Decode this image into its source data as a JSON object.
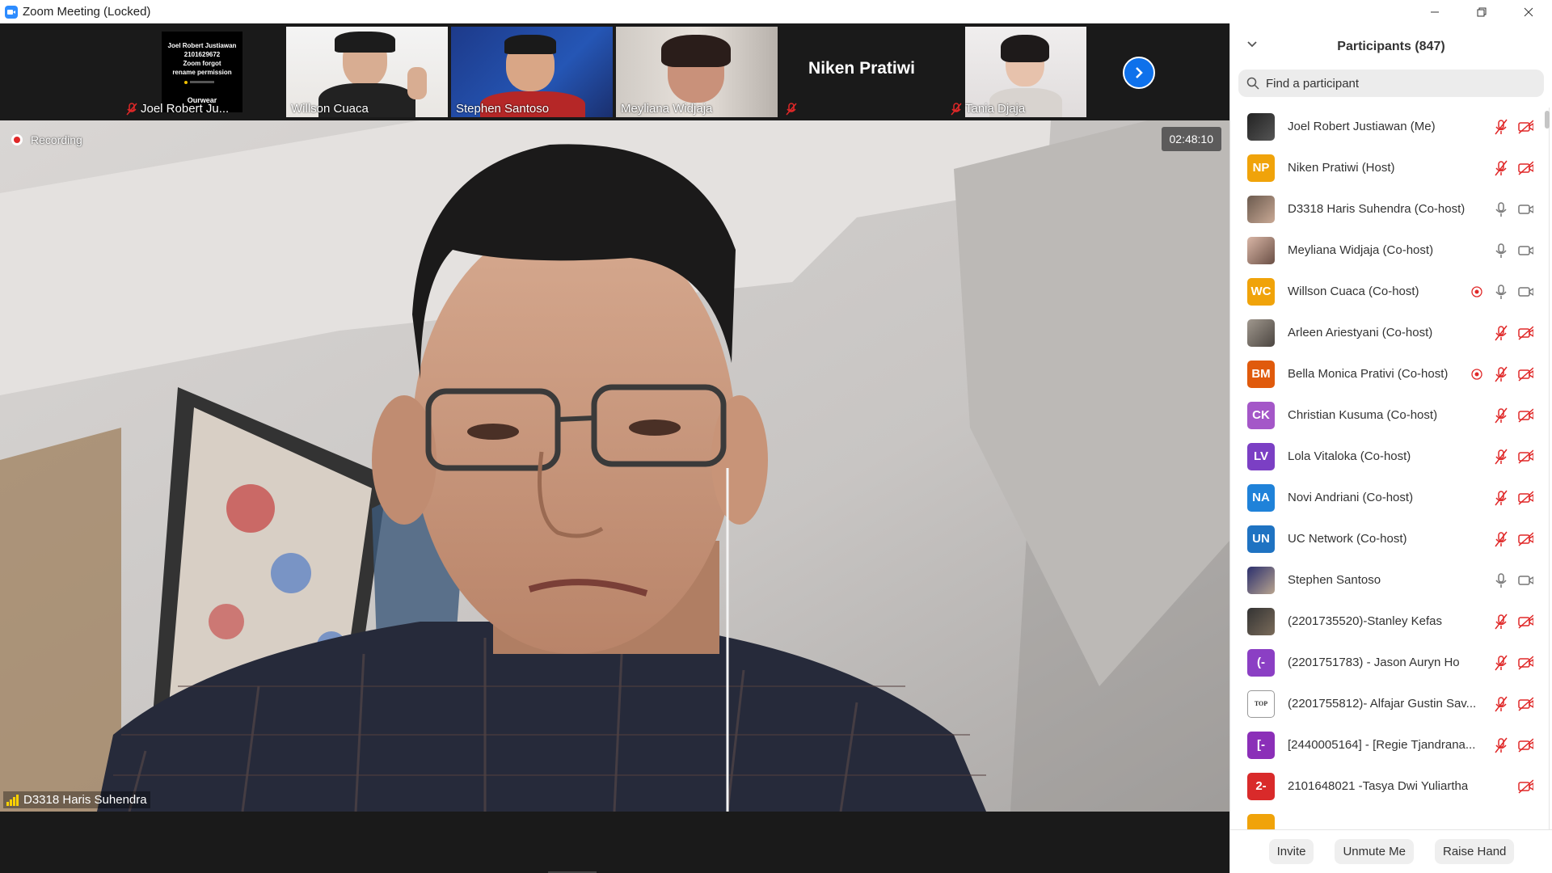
{
  "window": {
    "title": "Zoom Meeting (Locked)",
    "controls": {
      "minimize": "—",
      "restore": "❐",
      "close": "✕"
    }
  },
  "thumbnails": [
    {
      "name": "Joel Robert Ju...",
      "muted": true,
      "slide_text": "Joel Robert Justiawan\n2101629672\nZoom forgot\nrename permission\nOurwear"
    },
    {
      "name": "Willson Cuaca",
      "muted": false
    },
    {
      "name": "Stephen Santoso",
      "muted": false
    },
    {
      "name": "Meyliana Widjaja",
      "muted": false
    },
    {
      "name": "Niken Pratiwi",
      "muted": true
    },
    {
      "name": "Tania Djaja",
      "muted": true
    }
  ],
  "next_page_icon": "chevron-right-icon",
  "main_video": {
    "recording_label": "Recording",
    "timer": "02:48:10",
    "speaker_name": "D3318 Haris Suhendra"
  },
  "participants_panel": {
    "title": "Participants (847)",
    "search_placeholder": "Find a participant",
    "participants": [
      {
        "name": "Joel Robert Justiawan (Me)",
        "avatar_type": "dark",
        "initials": "",
        "recording": false,
        "mic": "muted",
        "video": "off"
      },
      {
        "name": "Niken Pratiwi (Host)",
        "avatar_type": "initials",
        "initials": "NP",
        "color": "#f0a30a",
        "recording": false,
        "mic": "muted",
        "video": "off"
      },
      {
        "name": "D3318 Haris Suhendra (Co-host)",
        "avatar_type": "photo",
        "initials": "",
        "recording": false,
        "mic": "on",
        "video": "on"
      },
      {
        "name": "Meyliana Widjaja (Co-host)",
        "avatar_type": "photo2",
        "initials": "",
        "recording": false,
        "mic": "on",
        "video": "on"
      },
      {
        "name": "Willson Cuaca (Co-host)",
        "avatar_type": "initials",
        "initials": "WC",
        "color": "#f0a30a",
        "recording": true,
        "mic": "on",
        "video": "on"
      },
      {
        "name": "Arleen Ariestyani (Co-host)",
        "avatar_type": "photo3",
        "initials": "",
        "recording": false,
        "mic": "muted",
        "video": "off"
      },
      {
        "name": "Bella Monica Prativi (Co-host)",
        "avatar_type": "initials",
        "initials": "BM",
        "color": "#e05a0c",
        "recording": true,
        "mic": "muted",
        "video": "off"
      },
      {
        "name": "Christian Kusuma (Co-host)",
        "avatar_type": "initials",
        "initials": "CK",
        "color": "#a457c8",
        "recording": false,
        "mic": "muted",
        "video": "off"
      },
      {
        "name": "Lola Vitaloka (Co-host)",
        "avatar_type": "initials",
        "initials": "LV",
        "color": "#7b3fc4",
        "recording": false,
        "mic": "muted",
        "video": "off"
      },
      {
        "name": "Novi Andriani (Co-host)",
        "avatar_type": "initials",
        "initials": "NA",
        "color": "#1f82d9",
        "recording": false,
        "mic": "muted",
        "video": "off"
      },
      {
        "name": "UC Network (Co-host)",
        "avatar_type": "initials",
        "initials": "UN",
        "color": "#1f73c2",
        "recording": false,
        "mic": "muted",
        "video": "off"
      },
      {
        "name": "Stephen Santoso",
        "avatar_type": "photo4",
        "initials": "",
        "recording": false,
        "mic": "on",
        "video": "on"
      },
      {
        "name": "(2201735520)-Stanley Kefas",
        "avatar_type": "photo5",
        "initials": "",
        "recording": false,
        "mic": "muted",
        "video": "off"
      },
      {
        "name": "(2201751783) - Jason Auryn Ho",
        "avatar_type": "initials",
        "initials": "(-",
        "color": "#8b3fc4",
        "recording": false,
        "mic": "muted",
        "video": "off"
      },
      {
        "name": "(2201755812)- Alfajar Gustin Sav...",
        "avatar_type": "logo",
        "initials": "TOP",
        "recording": false,
        "mic": "muted",
        "video": "off"
      },
      {
        "name": "[2440005164] - [Regie Tjandrana...",
        "avatar_type": "initials",
        "initials": "[-",
        "color": "#8b2fb8",
        "recording": false,
        "mic": "muted",
        "video": "off"
      },
      {
        "name": "2101648021 -Tasya Dwi Yuliartha",
        "avatar_type": "initials",
        "initials": "2-",
        "color": "#d92a2a",
        "recording": false,
        "mic": "none",
        "video": "off"
      }
    ],
    "footer": {
      "invite": "Invite",
      "unmute": "Unmute Me",
      "raise_hand": "Raise Hand"
    }
  }
}
